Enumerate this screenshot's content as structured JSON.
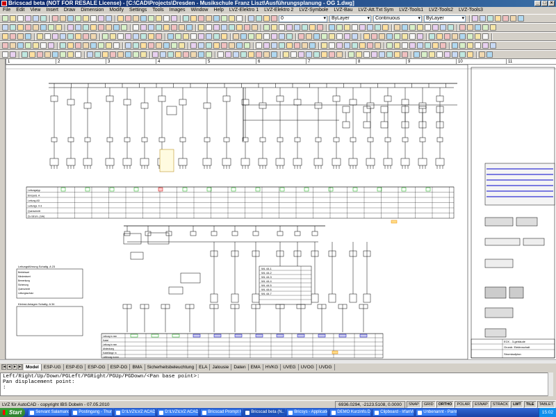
{
  "window": {
    "title": "Bricscad beta (NOT FOR RESALE License) - [C:\\CAD\\Projects\\Dresden - Musikschule Franz Liszt\\Ausführungsplanung - OG 1.dwg]"
  },
  "menu": [
    "File",
    "Edit",
    "View",
    "Insert",
    "Draw",
    "Dimension",
    "Modify",
    "Settings",
    "Tools",
    "Images",
    "Window",
    "Help",
    "LVZ-Elektro 1",
    "LVZ-Elektro 2",
    "LVZ-Symbole",
    "LVZ-Bau",
    "LVZ-Att.Txt Sym",
    "LVZ-Tools1",
    "LVZ-Tools2",
    "LVZ-Tools3"
  ],
  "toolbar": {
    "layer": "0",
    "color": "ByLayer",
    "linetype": "Continuous",
    "lineweight": "ByLayer"
  },
  "ruler": [
    "1",
    "2",
    "3",
    "4",
    "5",
    "6",
    "7",
    "8",
    "9",
    "10",
    "11"
  ],
  "tabs": [
    "Model",
    "ESP-UG",
    "ESP-EG",
    "ESP-OG",
    "ESP-DG",
    "BMA",
    "Sicherheitsbeleuchtung",
    "ELA",
    "Jalousie",
    "Daten",
    "EMA",
    "HVKG",
    "UVEG",
    "UVOG",
    "UVDG"
  ],
  "command": {
    "line1": "Left/Right/Up/Down/PGLeft/PGRight/PGUp/PGDown/<Pan base point>:",
    "line2": "Pan displacement point:",
    "line3": ":"
  },
  "status": {
    "left": "LVZ für AutoCAD - copyright IBS Dobeln - 07.05.2010",
    "coords": "6936.0294, -2123.5108, 0.0000",
    "modes": [
      "SNAP",
      "GRID",
      "ORTHO",
      "POLAR",
      "ESNAP",
      "STRACK",
      "LWT",
      "TILE",
      "TABLET"
    ]
  },
  "taskbar": {
    "start": "Start",
    "items": [
      "Servant Salamander",
      "Postingang - Thun...",
      "D:\\LVZ\\LVZ ACAD...",
      "D:\\LVZ\\LVZ ACAD...",
      "Bricscad Prompt Hist...",
      "Bricscad beta (N...",
      "Bricsys - Applications",
      "DEMO Kurzinfo.DOC...",
      "Clipboard - IrfanView",
      "Unbenannt - Paint"
    ],
    "clock": "15:02"
  },
  "drawing": {
    "title_block": {
      "line1": "ECK - 3-gebäude",
      "line2": "Grundr. Elektroschalt",
      "line3": "Stromlaufplan"
    },
    "tables": [
      {
        "rows": [
          "Leitungstyp",
          "Einspeis. A",
          "Leitung AD",
          "Leitungs. 0-3",
          "Querschnitt",
          "Zu-Strom. (mA)"
        ]
      },
      {
        "rows": [
          "Leitung in mm",
          "Kabel",
          "Leitung in mm",
          "Abdeckung",
          "Kabellänge m",
          "Lieferung in mm"
        ]
      }
    ],
    "legend": {
      "header": "Leitungsführung Schaltg. A 23",
      "header2": "Kleinst-Anlagen Schaltg. A 34",
      "lines": [
        "Betriebsart",
        "Mindestwert",
        "Bemerkung",
        "Sicherung",
        "Querschnitt",
        "Leitungsschutz"
      ]
    },
    "wl_labels": [
      "WL 44.1",
      "WL 44.2",
      "WL 44.3",
      "WL 44.4",
      "WL 44.5",
      "WL 44.6",
      "WL 44.7"
    ]
  }
}
